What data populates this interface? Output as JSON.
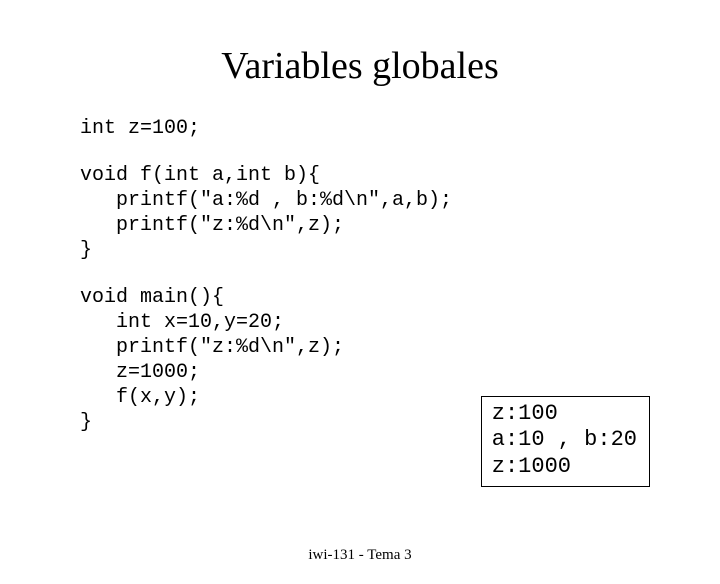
{
  "title": "Variables globales",
  "code": {
    "block1": "int z=100;",
    "block2": "void f(int a,int b){\n   printf(\"a:%d , b:%d\\n\",a,b);\n   printf(\"z:%d\\n\",z);\n}",
    "block3": "void main(){\n   int x=10,y=20;\n   printf(\"z:%d\\n\",z);\n   z=1000;\n   f(x,y);\n}"
  },
  "output": "z:100\na:10 , b:20\nz:1000",
  "footer": "iwi-131 - Tema 3"
}
